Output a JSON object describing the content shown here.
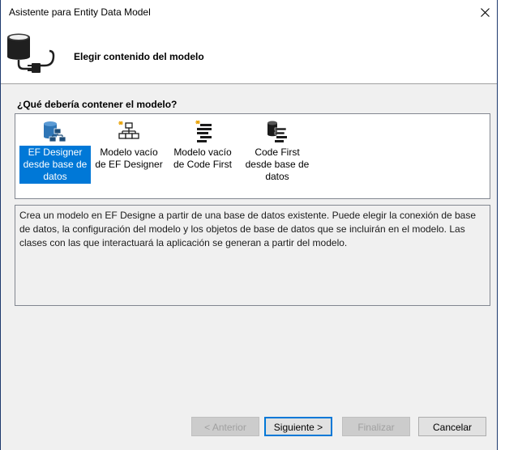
{
  "window": {
    "title": "Asistente para Entity Data Model"
  },
  "header": {
    "title": "Elegir contenido del modelo"
  },
  "main": {
    "question": "¿Qué debería contener el modelo?",
    "options": [
      {
        "label": "EF Designer desde base de datos",
        "icon": "database-diagram-icon",
        "selected": true
      },
      {
        "label": "Modelo vacío de EF Designer",
        "icon": "empty-model-icon",
        "selected": false
      },
      {
        "label": "Modelo vacío de Code First",
        "icon": "empty-code-first-icon",
        "selected": false
      },
      {
        "label": "Code First desde base de datos",
        "icon": "code-first-database-icon",
        "selected": false
      }
    ],
    "description": "Crea un modelo en EF Designe a partir de una base de datos existente. Puede elegir la conexión de base de datos, la configuración del modelo y los objetos de base de datos que se incluirán en el modelo. Las clases con las que interactuará la aplicación se generan a partir del modelo."
  },
  "footer": {
    "back_label": "< Anterior",
    "next_label": "Siguiente >",
    "finish_label": "Finalizar",
    "cancel_label": "Cancelar"
  },
  "colors": {
    "accent": "#0078d7",
    "window_border": "#1e3a6e"
  }
}
